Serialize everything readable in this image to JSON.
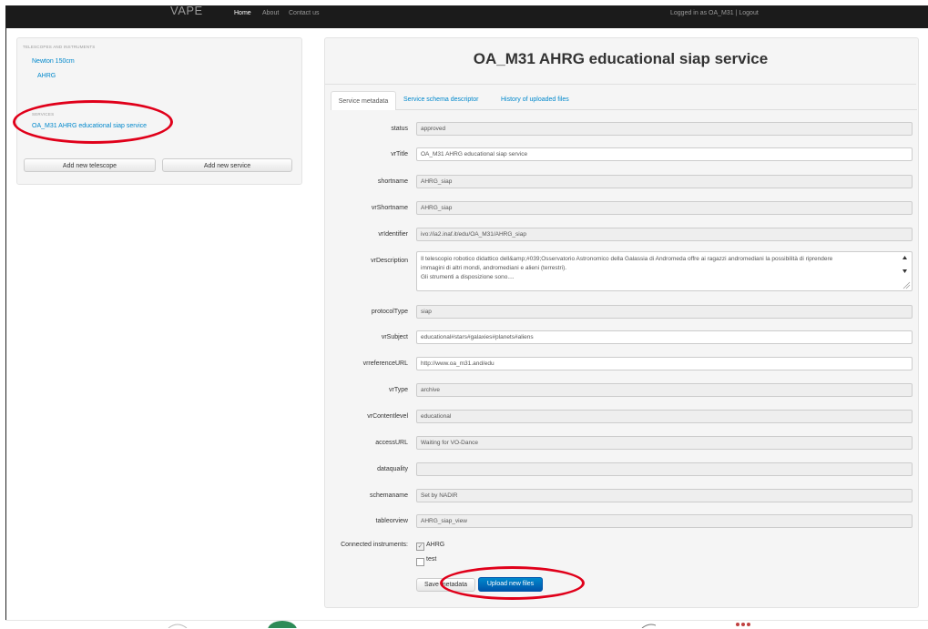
{
  "nav": {
    "brand": "VAPE",
    "home": "Home",
    "about": "About",
    "contact": "Contact us",
    "login_status": "Logged in as OA_M31 | Logout"
  },
  "sidebar": {
    "telescopes_header": "TELESCOPES AND INSTRUMENTS",
    "telescope": "Newton 150cm",
    "instrument": "AHRG",
    "services_header": "SERVICES",
    "service": "OA_M31 AHRG educational siap service",
    "add_telescope": "Add new telescope",
    "add_service": "Add new service"
  },
  "main": {
    "title": "OA_M31 AHRG educational siap service",
    "tabs": [
      "Service metadata",
      "Service schema descriptor",
      "History of uploaded files"
    ],
    "fields": {
      "status": {
        "label": "status",
        "value": "approved"
      },
      "vrTitle": {
        "label": "vrTitle",
        "value": "OA_M31 AHRG educational siap service"
      },
      "shortname": {
        "label": "shortname",
        "value": "AHRG_siap"
      },
      "vrShortname": {
        "label": "vrShortname",
        "value": "AHRG_siap"
      },
      "vrIdentifier": {
        "label": "vrIdentifier",
        "value": "ivo://ia2.inaf.it/edu/OA_M31/AHRG_siap"
      },
      "vrDescription": {
        "label": "vrDescription",
        "lines": [
          "Il telescopio robotico didattico dell&amp;#039;Osservatorio Astronomico della Galassia di Andromeda offre ai ragazzi andromediani la possibilità di riprendere",
          "immagini di altri mondi, andromediani e alieni (terrestri).",
          "Gli strumenti a disposizione sono...."
        ]
      },
      "protocolType": {
        "label": "protocolType",
        "value": "siap"
      },
      "vrSubject": {
        "label": "vrSubject",
        "value": "educational#stars#galaxies#planets#aliens"
      },
      "vrreferenceURL": {
        "label": "vrreferenceURL",
        "value": "http://www.oa_m31.and/edu"
      },
      "vrType": {
        "label": "vrType",
        "value": "archive"
      },
      "vrContentlevel": {
        "label": "vrContentlevel",
        "value": "educational"
      },
      "accessURL": {
        "label": "accessURL",
        "value": "Waiting for VO-Dance"
      },
      "dataquality": {
        "label": "dataquality",
        "value": ""
      },
      "schemaname": {
        "label": "schemaname",
        "value": "Set by NADIR"
      },
      "tableorview": {
        "label": "tableorview",
        "value": "AHRG_siap_view"
      }
    },
    "connected_label": "Connected instruments:",
    "instruments": [
      {
        "name": "AHRG",
        "checked": true,
        "check_glyph": "✓"
      },
      {
        "name": "test",
        "checked": false,
        "check_glyph": ""
      }
    ],
    "save_label": "Save metadata",
    "upload_label": "Upload new files"
  },
  "colors": {
    "navbar": "#1b1b1b",
    "link": "#0088cc",
    "primary_button": "#0066bb",
    "annotation": "#e0001a"
  }
}
